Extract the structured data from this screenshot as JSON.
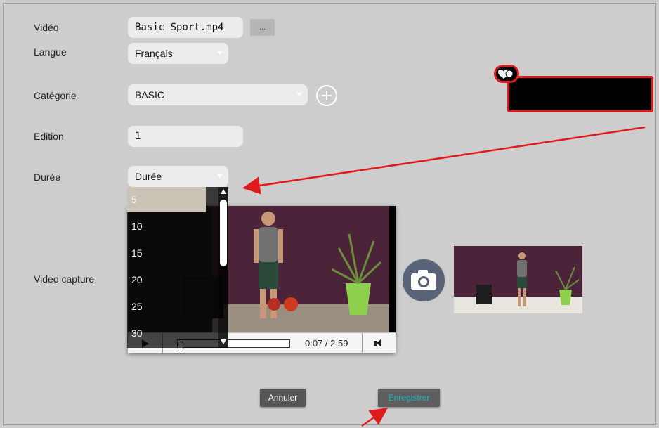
{
  "form": {
    "video": {
      "label": "Vidéo",
      "value": "Basic Sport.mp4",
      "browse_label": "..."
    },
    "langue": {
      "label": "Langue",
      "value": "Français"
    },
    "categorie": {
      "label": "Catégorie",
      "value": "BASIC"
    },
    "edition": {
      "label": "Edition",
      "value": "1"
    },
    "duree": {
      "label": "Durée",
      "value": "Durée",
      "options": [
        "5",
        "10",
        "15",
        "20",
        "25",
        "30"
      ],
      "highlighted_option": "5"
    },
    "video_capture": {
      "label": "Video capture"
    }
  },
  "player": {
    "current_time": "0:07",
    "duration": "2:59",
    "time_display": "0:07 / 2:59",
    "progress": 0.04
  },
  "buttons": {
    "cancel": "Annuler",
    "save": "Enregistrer"
  },
  "colors": {
    "background": "#cdcdcd",
    "save_text": "#19b8c4",
    "annotation": "#e0191b",
    "camera": "#5a6478"
  },
  "icons": {
    "add": "plus-circle-icon",
    "camera": "camera-icon",
    "play": "play-icon",
    "volume": "volume-icon"
  }
}
